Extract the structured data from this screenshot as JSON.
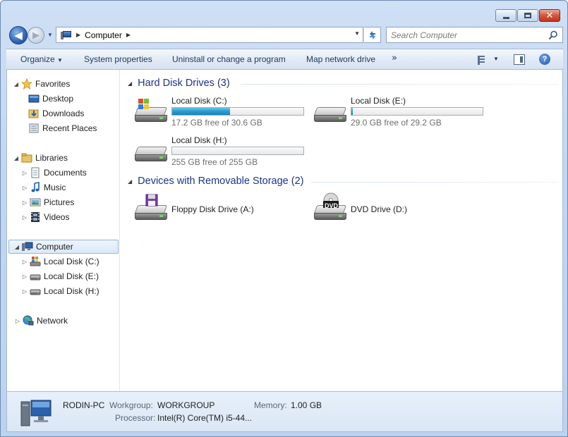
{
  "address": {
    "crumb": "Computer"
  },
  "search": {
    "placeholder": "Search Computer"
  },
  "toolbar": {
    "organize": "Organize",
    "system_properties": "System properties",
    "uninstall": "Uninstall or change a program",
    "map_drive": "Map network drive",
    "more": "»"
  },
  "nav": {
    "favorites": "Favorites",
    "desktop": "Desktop",
    "downloads": "Downloads",
    "recent": "Recent Places",
    "libraries": "Libraries",
    "documents": "Documents",
    "music": "Music",
    "pictures": "Pictures",
    "videos": "Videos",
    "computer": "Computer",
    "disk_c": "Local Disk (C:)",
    "disk_e": "Local Disk (E:)",
    "disk_h": "Local Disk (H:)",
    "network": "Network"
  },
  "groups": {
    "hdd": "Hard Disk Drives (3)",
    "removable": "Devices with Removable Storage (2)"
  },
  "drives": [
    {
      "name": "Local Disk (C:)",
      "free": "17.2 GB free of 30.6 GB",
      "used_fraction": 0.44
    },
    {
      "name": "Local Disk (E:)",
      "free": "29.0 GB free of 29.2 GB",
      "used_fraction": 0.01
    },
    {
      "name": "Local Disk (H:)",
      "free": "255 GB free of 255 GB",
      "used_fraction": 0.0
    }
  ],
  "devices": [
    {
      "name": "Floppy Disk Drive (A:)"
    },
    {
      "name": "DVD Drive (D:)",
      "badge": "DVD"
    }
  ],
  "details": {
    "pc_name": "RODIN-PC",
    "workgroup_label": "Workgroup:",
    "workgroup": "WORKGROUP",
    "memory_label": "Memory:",
    "memory": "1.00 GB",
    "processor_label": "Processor:",
    "processor": "Intel(R) Core(TM) i5-44..."
  },
  "colors": {
    "accent": "#1e3287",
    "usage_bar": "#2aa0d4"
  },
  "icons": {
    "star": "favorites-star-icon",
    "folder": "folder-icon",
    "computer": "computer-icon",
    "network": "network-globe-icon"
  }
}
